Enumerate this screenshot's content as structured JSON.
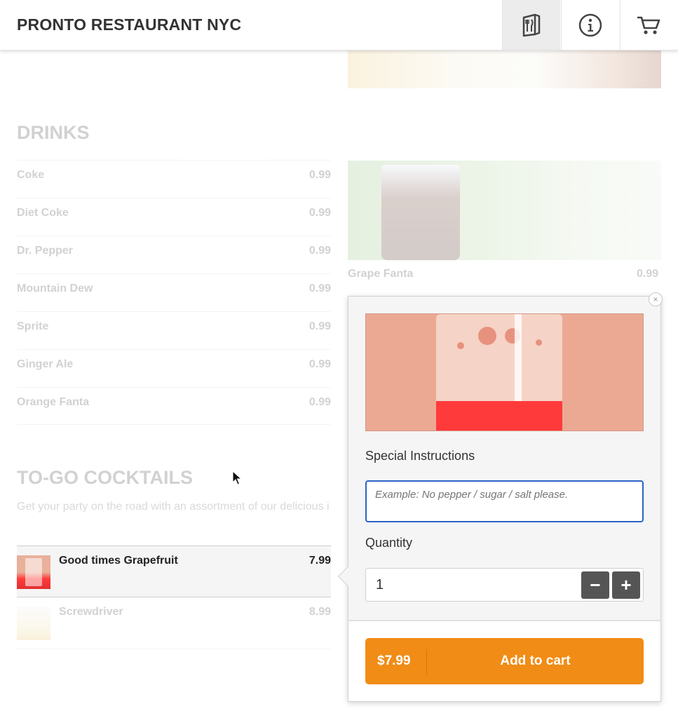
{
  "header": {
    "brand": "PRONTO RESTAURANT NYC",
    "icons": [
      "menu-icon",
      "info-icon",
      "cart-icon"
    ]
  },
  "drinks": {
    "title": "DRINKS",
    "items": [
      {
        "name": "Coke",
        "price": "0.99"
      },
      {
        "name": "Diet Coke",
        "price": "0.99"
      },
      {
        "name": "Dr. Pepper",
        "price": "0.99"
      },
      {
        "name": "Mountain Dew",
        "price": "0.99"
      },
      {
        "name": "Sprite",
        "price": "0.99"
      },
      {
        "name": "Ginger Ale",
        "price": "0.99"
      },
      {
        "name": "Orange Fanta",
        "price": "0.99"
      }
    ],
    "featured": {
      "name": "Grape Fanta",
      "price": "0.99"
    }
  },
  "cocktails": {
    "title": "TO-GO COCKTAILS",
    "description": "Get your party on the road with an assortment of our delicious i",
    "items": [
      {
        "name": "Good times Grapefruit",
        "price": "7.99"
      },
      {
        "name": "Screwdriver",
        "price": "8.99"
      }
    ]
  },
  "popup": {
    "close_label": "×",
    "instructions_label": "Special Instructions",
    "instructions_placeholder": "Example: No pepper / sugar / salt please.",
    "quantity_label": "Quantity",
    "quantity_value": "1",
    "minus_label": "−",
    "plus_label": "+",
    "total": "$7.99",
    "add_label": "Add to cart"
  },
  "colors": {
    "accent": "#f18c16",
    "focus": "#2a63c5",
    "stepper": "#555555"
  }
}
